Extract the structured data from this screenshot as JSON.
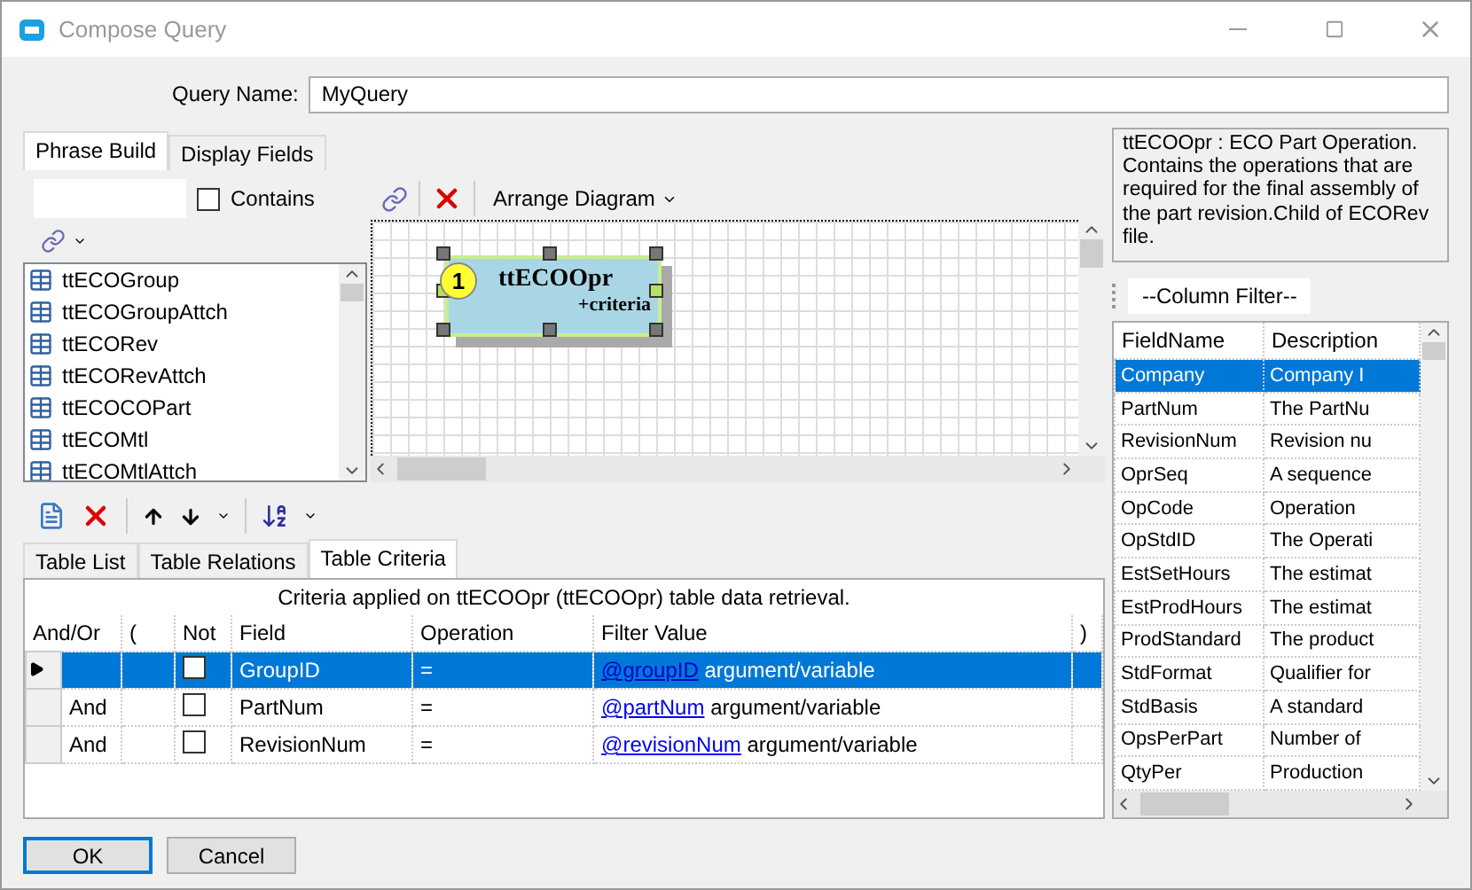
{
  "window": {
    "title": "Compose Query"
  },
  "query_name": {
    "label": "Query Name:",
    "value": "MyQuery"
  },
  "main_tabs": [
    {
      "label": "Phrase Build",
      "selected": true
    },
    {
      "label": "Display Fields",
      "selected": false
    }
  ],
  "contains": {
    "label": "Contains",
    "checked": false
  },
  "table_list": [
    {
      "name": "ttECOGroup",
      "selected": false
    },
    {
      "name": "ttECOGroupAttch",
      "selected": false
    },
    {
      "name": "ttECORev",
      "selected": false
    },
    {
      "name": "ttECORevAttch",
      "selected": false
    },
    {
      "name": "ttECOCOPart",
      "selected": false
    },
    {
      "name": "ttECOMtl",
      "selected": false
    },
    {
      "name": "ttECOMtlAttch",
      "selected": false
    }
  ],
  "diagram": {
    "arrange_label": "Arrange Diagram",
    "node": {
      "number": "1",
      "name": "ttECOOpr",
      "subtitle": "+criteria",
      "selected": true
    }
  },
  "bottom_tabs": [
    {
      "label": "Table List",
      "selected": false
    },
    {
      "label": "Table Relations",
      "selected": false
    },
    {
      "label": "Table Criteria",
      "selected": true
    }
  ],
  "criteria": {
    "caption": "Criteria applied on ttECOOpr (ttECOOpr)  table data retrieval.",
    "columns": [
      "And/Or",
      "(",
      "Not",
      "Field",
      "Operation",
      "Filter Value",
      ")"
    ],
    "rows": [
      {
        "and_or": "",
        "not": false,
        "field": "GroupID",
        "operation": "=",
        "filter_link": "@groupID",
        "filter_text": "argument/variable",
        "selected": true
      },
      {
        "and_or": "And",
        "not": false,
        "field": "PartNum",
        "operation": "=",
        "filter_link": "@partNum",
        "filter_text": "argument/variable",
        "selected": false
      },
      {
        "and_or": "And",
        "not": false,
        "field": "RevisionNum",
        "operation": "=",
        "filter_link": "@revisionNum",
        "filter_text": "argument/variable",
        "selected": false
      }
    ]
  },
  "description": "ttECOOpr : ECO Part Operation. Contains the operations that are required for the final assembly of the part revision.Child of ECORev file.",
  "column_filter": "--Column Filter--",
  "fields": {
    "columns": [
      "FieldName",
      "Description"
    ],
    "rows": [
      {
        "field_name": "Company",
        "description": "Company I",
        "selected": true
      },
      {
        "field_name": "PartNum",
        "description": "The PartNu",
        "selected": false
      },
      {
        "field_name": "RevisionNum",
        "description": "Revision nu",
        "selected": false
      },
      {
        "field_name": "OprSeq",
        "description": "A sequence",
        "selected": false
      },
      {
        "field_name": "OpCode",
        "description": "Operation",
        "selected": false
      },
      {
        "field_name": "OpStdID",
        "description": "The Operati",
        "selected": false
      },
      {
        "field_name": "EstSetHours",
        "description": "The estimat",
        "selected": false
      },
      {
        "field_name": "EstProdHours",
        "description": "The estimat",
        "selected": false
      },
      {
        "field_name": "ProdStandard",
        "description": "The product",
        "selected": false
      },
      {
        "field_name": "StdFormat",
        "description": "Qualifier for",
        "selected": false
      },
      {
        "field_name": "StdBasis",
        "description": "A standard",
        "selected": false
      },
      {
        "field_name": "OpsPerPart",
        "description": "Number of",
        "selected": false
      },
      {
        "field_name": "QtyPer",
        "description": "Production",
        "selected": false
      }
    ]
  },
  "buttons": [
    {
      "label": "OK",
      "kind": "primary"
    },
    {
      "label": "Cancel",
      "kind": "default"
    }
  ]
}
